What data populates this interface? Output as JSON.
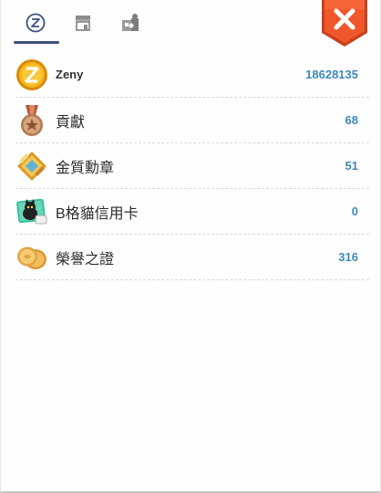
{
  "tabs": [
    {
      "name": "zeny-tab",
      "icon": "zeny-circle-icon",
      "active": true
    },
    {
      "name": "shop-tab",
      "icon": "shop-icon",
      "active": false
    },
    {
      "name": "puzzle-tab",
      "icon": "puzzle-icon",
      "active": false
    }
  ],
  "close": {
    "icon": "close-icon",
    "color": "#e8502a"
  },
  "currencies": [
    {
      "label": "Zeny",
      "value": "18628135",
      "icon": "zeny-coin-icon"
    },
    {
      "label": "貢獻",
      "value": "68",
      "icon": "contribution-medal-icon"
    },
    {
      "label": "金質勳章",
      "value": "51",
      "icon": "gold-medal-icon"
    },
    {
      "label": "B格貓信用卡",
      "value": "0",
      "icon": "cat-credit-card-icon"
    },
    {
      "label": "榮譽之證",
      "value": "316",
      "icon": "honor-coins-icon"
    }
  ],
  "colors": {
    "value_text": "#3d8ab8",
    "tab_active": "#3f4f7e"
  }
}
